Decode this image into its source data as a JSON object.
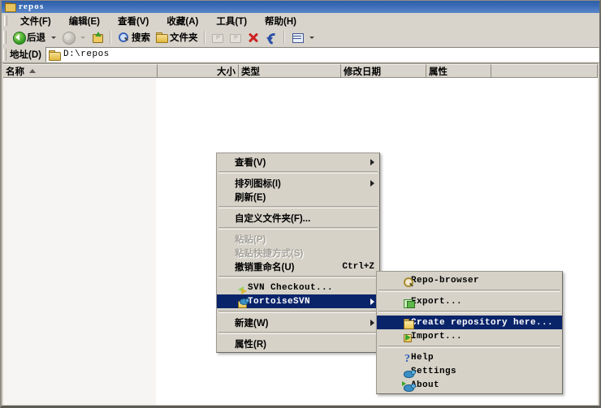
{
  "window": {
    "title": "repos",
    "icon": "folder-icon"
  },
  "menubar": {
    "items": [
      {
        "label": "文件(F)",
        "name": "menu-file"
      },
      {
        "label": "编辑(E)",
        "name": "menu-edit"
      },
      {
        "label": "查看(V)",
        "name": "menu-view"
      },
      {
        "label": "收藏(A)",
        "name": "menu-favorites"
      },
      {
        "label": "工具(T)",
        "name": "menu-tools"
      },
      {
        "label": "帮助(H)",
        "name": "menu-help"
      }
    ]
  },
  "toolbar": {
    "back_label": "后退",
    "search_label": "搜索",
    "folders_label": "文件夹"
  },
  "address": {
    "label": "地址(D)",
    "value": "D:\\repos"
  },
  "columns": [
    {
      "label": "名称",
      "sorted": true
    },
    {
      "label": "大小"
    },
    {
      "label": "类型"
    },
    {
      "label": "修改日期"
    },
    {
      "label": "属性"
    },
    {
      "label": ""
    }
  ],
  "context_menu": {
    "items": [
      {
        "label": "查看(V)",
        "submenu": true,
        "disabled": false,
        "selected": false,
        "accel": "",
        "icon": ""
      },
      {
        "separator": true
      },
      {
        "label": "排列图标(I)",
        "submenu": true,
        "disabled": false,
        "selected": false,
        "accel": "",
        "icon": ""
      },
      {
        "label": "刷新(E)",
        "submenu": false,
        "disabled": false,
        "selected": false,
        "accel": "",
        "icon": ""
      },
      {
        "separator": true
      },
      {
        "label": "自定义文件夹(F)...",
        "submenu": false,
        "disabled": false,
        "selected": false,
        "accel": "",
        "icon": ""
      },
      {
        "separator": true
      },
      {
        "label": "粘贴(P)",
        "submenu": false,
        "disabled": true,
        "selected": false,
        "accel": "",
        "icon": ""
      },
      {
        "label": "粘贴快捷方式(S)",
        "submenu": false,
        "disabled": true,
        "selected": false,
        "accel": "",
        "icon": ""
      },
      {
        "label": "撤销重命名(U)",
        "submenu": false,
        "disabled": false,
        "selected": false,
        "accel": "Ctrl+Z",
        "icon": ""
      },
      {
        "separator": true
      },
      {
        "label": "SVN Checkout...",
        "submenu": false,
        "disabled": false,
        "selected": false,
        "accel": "",
        "icon": "svn-checkout-icon",
        "mono": true
      },
      {
        "label": "TortoiseSVN",
        "submenu": true,
        "disabled": false,
        "selected": true,
        "accel": "",
        "icon": "tortoisesvn-icon",
        "mono": true
      },
      {
        "separator": true
      },
      {
        "label": "新建(W)",
        "submenu": true,
        "disabled": false,
        "selected": false,
        "accel": "",
        "icon": ""
      },
      {
        "separator": true
      },
      {
        "label": "属性(R)",
        "submenu": false,
        "disabled": false,
        "selected": false,
        "accel": "",
        "icon": ""
      }
    ]
  },
  "submenu": {
    "items": [
      {
        "label": "Repo-browser",
        "selected": false,
        "icon": "repo-browser-icon"
      },
      {
        "separator": true
      },
      {
        "label": "Export...",
        "selected": false,
        "icon": "export-icon"
      },
      {
        "separator": true
      },
      {
        "label": "Create repository here...",
        "selected": true,
        "icon": "create-repository-icon"
      },
      {
        "label": "Import...",
        "selected": false,
        "icon": "import-icon"
      },
      {
        "separator": true
      },
      {
        "label": "Help",
        "selected": false,
        "icon": "help-icon"
      },
      {
        "label": "Settings",
        "selected": false,
        "icon": "settings-icon"
      },
      {
        "label": "About",
        "selected": false,
        "icon": "about-icon"
      }
    ]
  },
  "colors": {
    "titlebar": "#3a6bb5",
    "menu_highlight": "#0a246a",
    "chrome": "#d6d2c8"
  }
}
